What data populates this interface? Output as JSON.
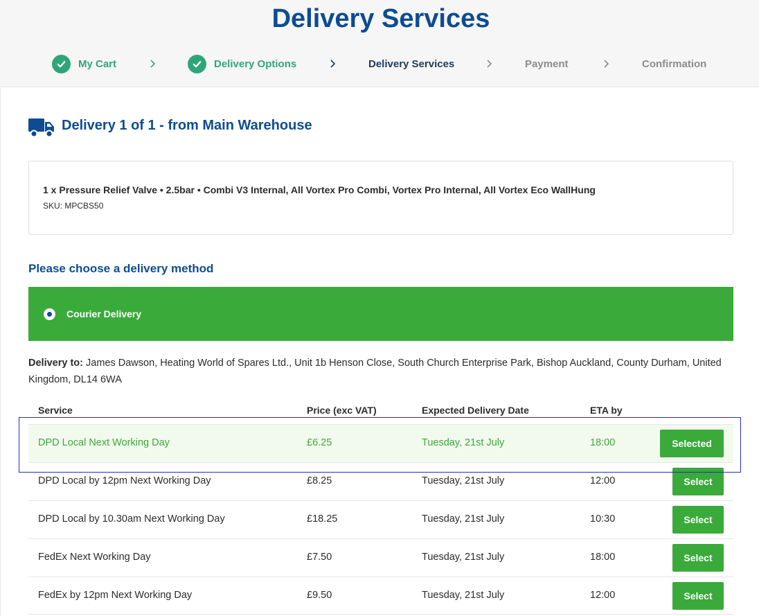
{
  "header": {
    "title": "Delivery Services"
  },
  "steps": [
    {
      "label": "My Cart",
      "state": "done"
    },
    {
      "label": "Delivery Options",
      "state": "done"
    },
    {
      "label": "Delivery Services",
      "state": "current"
    },
    {
      "label": "Payment",
      "state": "future"
    },
    {
      "label": "Confirmation",
      "state": "future"
    }
  ],
  "delivery": {
    "heading": "Delivery 1 of 1 - from Main Warehouse",
    "icon": "truck-icon",
    "item": {
      "name": "1 x Pressure Relief Valve • 2.5bar • Combi V3 Internal, All Vortex Pro Combi, Vortex Pro Internal, All Vortex Eco WallHung",
      "sku": "SKU: MPCBS50"
    },
    "choose_label": "Please choose a delivery method",
    "method": {
      "label": "Courier Delivery",
      "selected": true
    },
    "delivery_to": {
      "label": "Delivery to:",
      "address": "James Dawson, Heating World of Spares Ltd., Unit 1b Henson Close, South Church Enterprise Park, Bishop Auckland, County Durham, United Kingdom, DL14 6WA"
    }
  },
  "table": {
    "headers": {
      "service": "Service",
      "price": "Price (exc VAT)",
      "date": "Expected Delivery Date",
      "eta": "ETA by"
    },
    "rows": [
      {
        "service": "DPD Local Next Working Day",
        "price": "£6.25",
        "date": "Tuesday, 21st July",
        "eta": "18:00",
        "button": "Selected"
      },
      {
        "service": "DPD Local by 12pm Next Working Day",
        "price": "£8.25",
        "date": "Tuesday, 21st July",
        "eta": "12:00",
        "button": "Select"
      },
      {
        "service": "DPD Local by 10.30am Next Working Day",
        "price": "£18.25",
        "date": "Tuesday, 21st July",
        "eta": "10:30",
        "button": "Select"
      },
      {
        "service": "FedEx Next Working Day",
        "price": "£7.50",
        "date": "Tuesday, 21st July",
        "eta": "18:00",
        "button": "Select"
      },
      {
        "service": "FedEx by 12pm Next Working Day",
        "price": "£9.50",
        "date": "Tuesday, 21st July",
        "eta": "12:00",
        "button": "Select"
      }
    ]
  },
  "colors": {
    "brand_blue": "#0d4c93",
    "success_green": "#3aaa3a",
    "step_done": "#2fa57a",
    "highlight": "#2030c0"
  }
}
